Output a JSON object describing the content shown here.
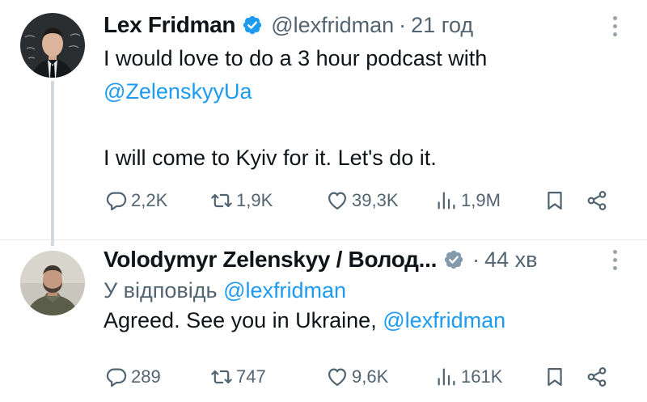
{
  "tweets": [
    {
      "author": "Lex Fridman",
      "handle": "@lexfridman",
      "time": "21 год",
      "text_line1": "I would love to do a 3 hour podcast with",
      "mention": "@ZelenskyyUa",
      "text_line3": "I will come to Kyiv for it. Let's do it.",
      "stats": {
        "replies": "2,2K",
        "reposts": "1,9K",
        "likes": "39,3K",
        "views": "1,9M"
      }
    },
    {
      "author": "Volodymyr Zelenskyy / Волод...",
      "time": "44 хв",
      "reply_to_label": "У відповідь",
      "reply_to_handle": "@lexfridman",
      "text": "Agreed. See you in Ukraine,",
      "mention": "@lexfridman",
      "stats": {
        "replies": "289",
        "reposts": "747",
        "likes": "9,6K",
        "views": "161K"
      }
    }
  ],
  "separator": "·",
  "colors": {
    "verified_blue": "#1d9bf0",
    "verified_gov_gray": "#829aab",
    "link": "#1d9bf0",
    "muted": "#536471"
  },
  "icons": [
    "reply-icon",
    "repost-icon",
    "like-icon",
    "views-icon",
    "bookmark-icon",
    "share-icon",
    "more-icon",
    "verified-icon"
  ]
}
